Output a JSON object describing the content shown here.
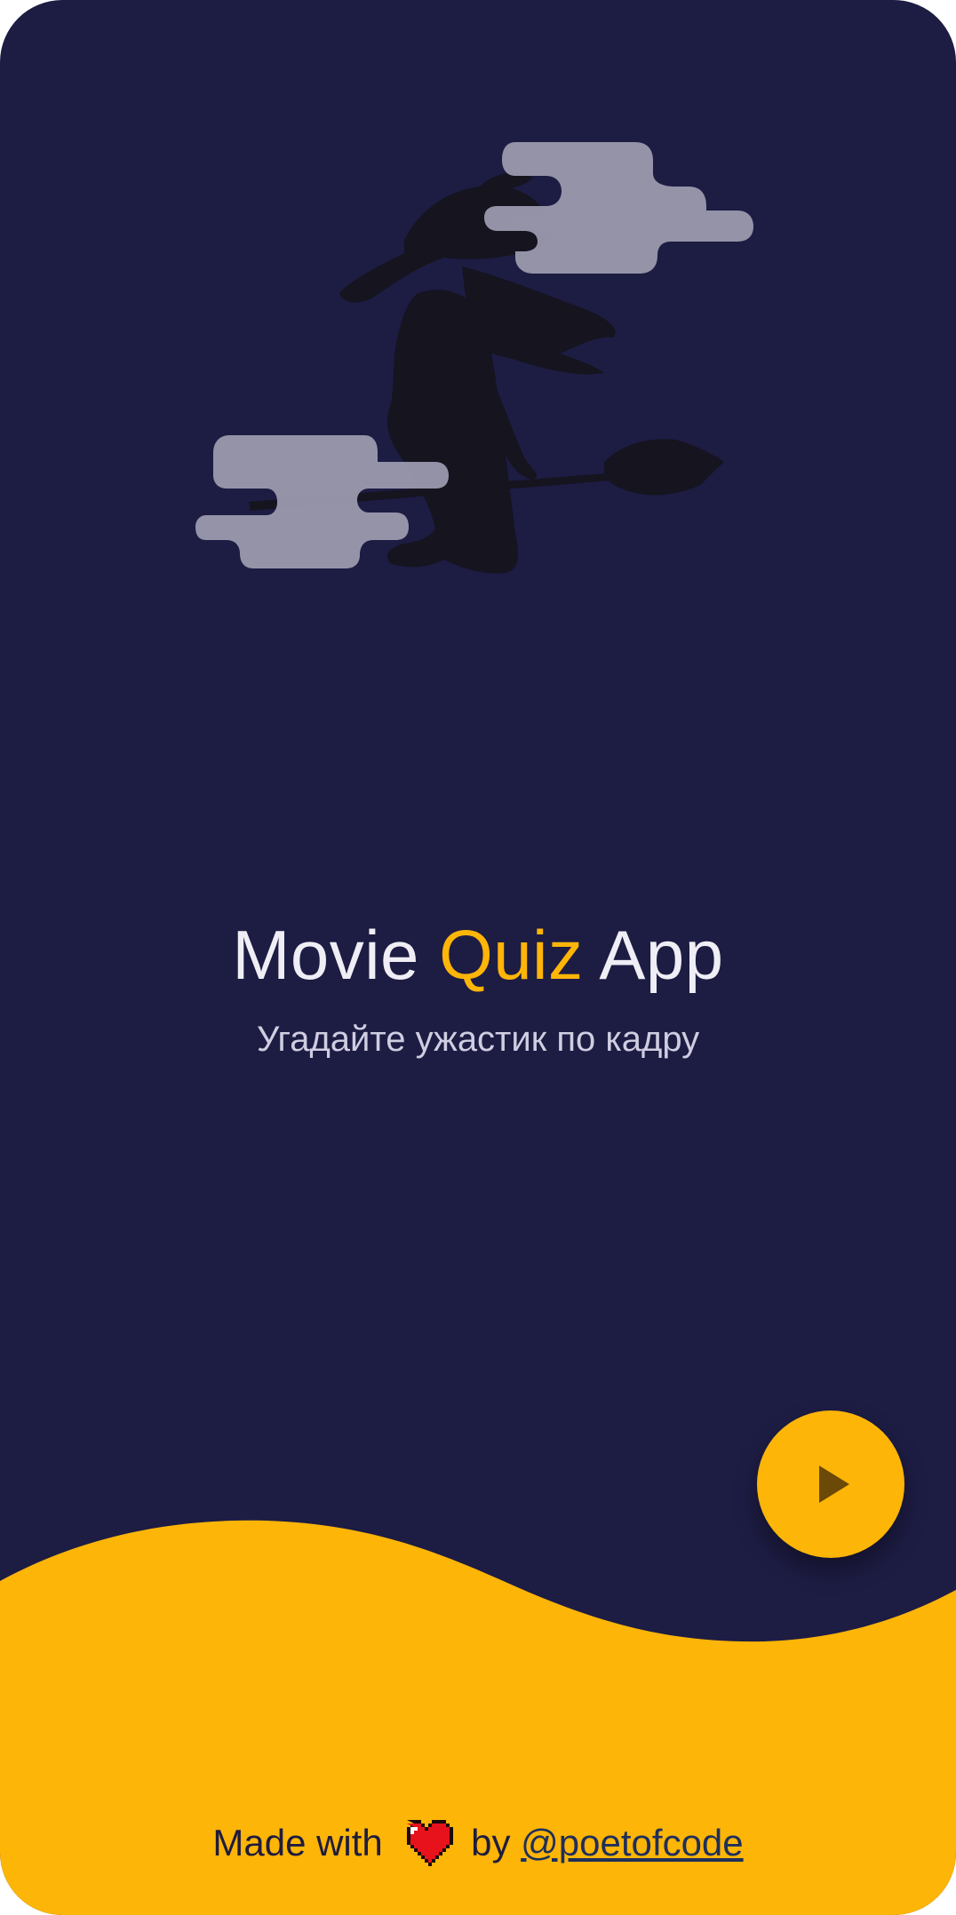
{
  "app": {
    "title_part1": "Movie",
    "title_accent": "Quiz",
    "title_part3": "App",
    "subtitle": "Угадайте ужастик по кадру"
  },
  "actions": {
    "play_icon": "play-icon"
  },
  "footer": {
    "made_with": "Made with",
    "heart_icon": "heart-icon",
    "by": "by",
    "author_link": "@poetofcode"
  },
  "colors": {
    "background": "#1d1c43",
    "accent": "#fdb508",
    "title": "#efeef5",
    "subtitle": "#cfcde0",
    "cloud": "#9a99ab",
    "silhouette": "#15141f"
  }
}
